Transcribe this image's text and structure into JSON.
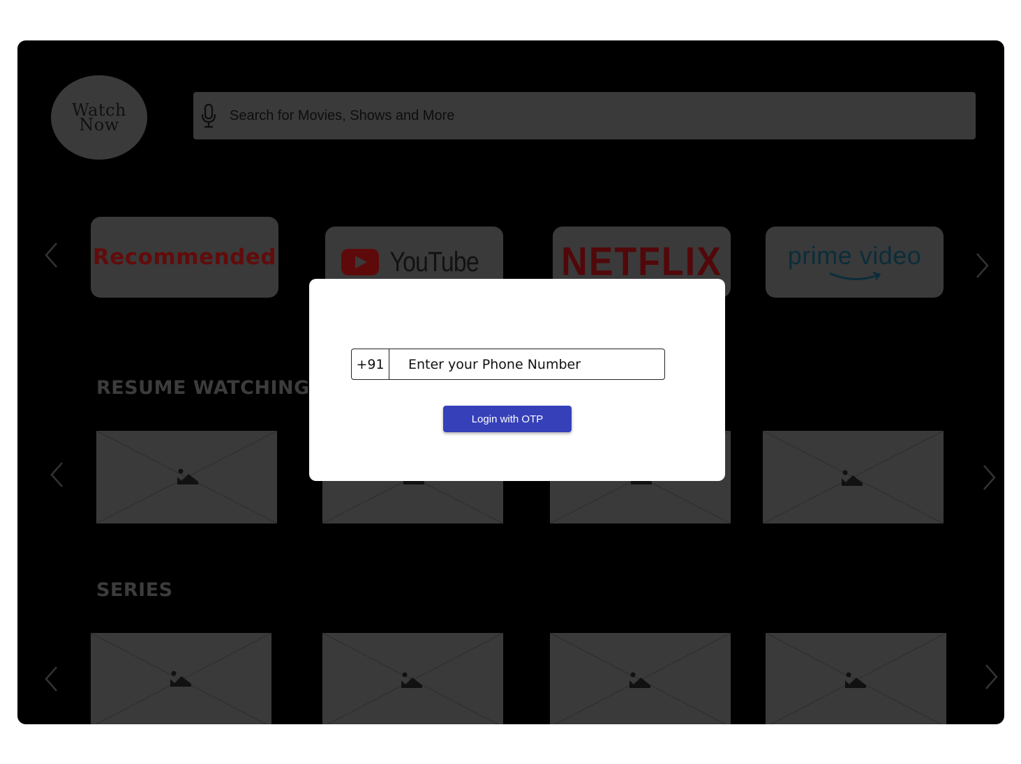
{
  "logo": {
    "line1": "Watch",
    "line2": "Now"
  },
  "search": {
    "placeholder": "Search for  Movies, Shows and More",
    "icon": "mic-icon"
  },
  "providers": [
    {
      "label": "Recommended"
    },
    {
      "label": "YouTube"
    },
    {
      "label": "NETFLIX"
    },
    {
      "label": "prime video"
    }
  ],
  "sections": {
    "resume_watching": "RESUME WATCHING",
    "series": "SERIES"
  },
  "modal": {
    "country_code": "+91",
    "phone_placeholder": "Enter your Phone Number",
    "otp_button": "Login with OTP"
  },
  "colors": {
    "modal_button": "#3640b9",
    "backdrop": "#000000",
    "dimmed_surface": "#3a3a3a"
  }
}
